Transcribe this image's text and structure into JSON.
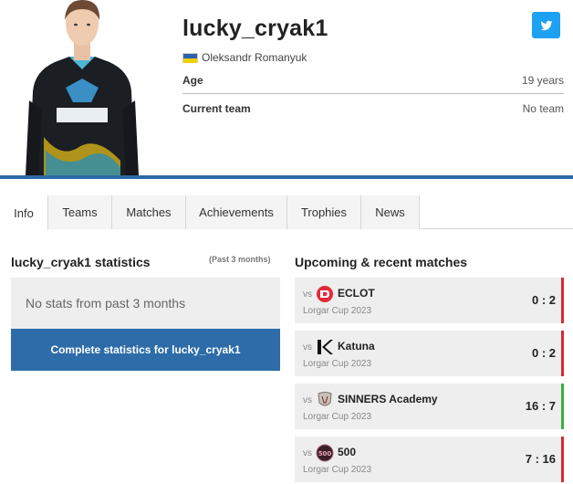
{
  "player": {
    "nickname": "lucky_cryak1",
    "real_name": "Oleksandr Romanyuk",
    "country_flag": "ukraine-flag",
    "rows": [
      {
        "label": "Age",
        "value": "19 years"
      },
      {
        "label": "Current team",
        "value": "No team"
      }
    ],
    "social_icon": "twitter-icon"
  },
  "tabs": [
    {
      "label": "Info",
      "active": true
    },
    {
      "label": "Teams",
      "active": false
    },
    {
      "label": "Matches",
      "active": false
    },
    {
      "label": "Achievements",
      "active": false
    },
    {
      "label": "Trophies",
      "active": false
    },
    {
      "label": "News",
      "active": false
    }
  ],
  "stats": {
    "title": "lucky_cryak1 statistics",
    "period": "(Past 3 months)",
    "empty_text": "No stats from past 3 months",
    "button_label": "Complete statistics for lucky_cryak1"
  },
  "matches": {
    "title": "Upcoming & recent matches",
    "vs_label": "vs",
    "items": [
      {
        "opponent": "ECLOT",
        "logo": "eclot-logo-icon",
        "tournament": "Lorgar Cup 2023",
        "score": "0 : 2",
        "result": "loss"
      },
      {
        "opponent": "Katuna",
        "logo": "katuna-logo-icon",
        "tournament": "Lorgar Cup 2023",
        "score": "0 : 2",
        "result": "loss"
      },
      {
        "opponent": "SINNERS Academy",
        "logo": "sinners-logo-icon",
        "tournament": "Lorgar Cup 2023",
        "score": "16 : 7",
        "result": "win"
      },
      {
        "opponent": "500",
        "logo": "500-logo-icon",
        "tournament": "Lorgar Cup 2023",
        "score": "7 : 16",
        "result": "loss"
      }
    ]
  },
  "colors": {
    "accent_blue": "#2e6aa5",
    "loss": "#d62c2c",
    "win": "#35b23a",
    "twitter": "#1da1f2"
  }
}
